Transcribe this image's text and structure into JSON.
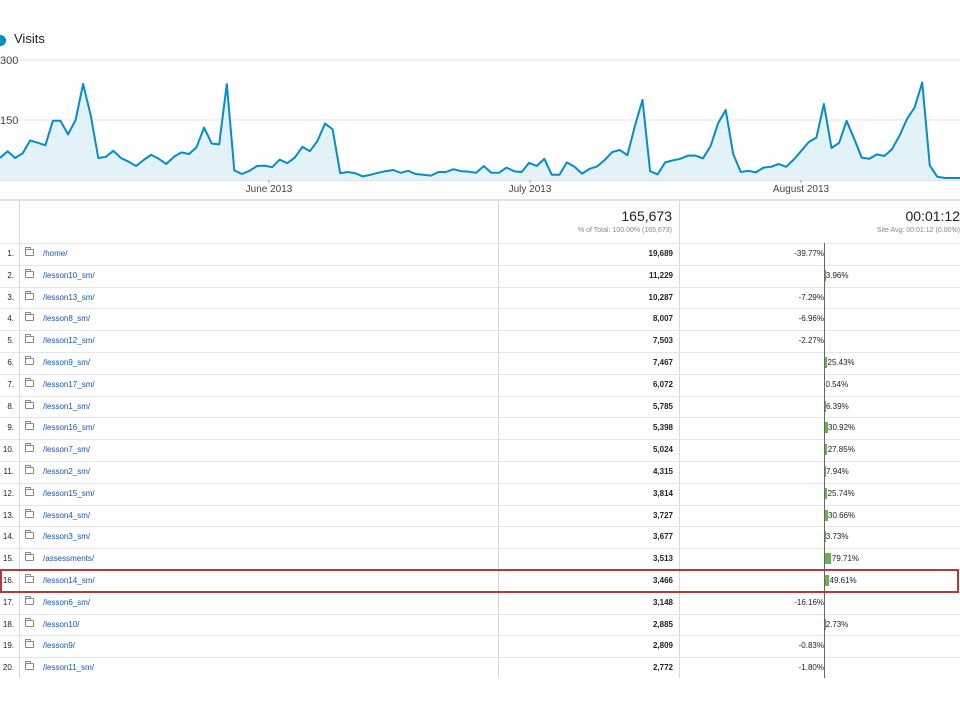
{
  "chart": {
    "legend_label": "Visits",
    "series_color": "#058dc7",
    "fill_color": "#e3f1f8",
    "y_ticks": [
      "300",
      "150"
    ],
    "y_max": 300,
    "x_labels": [
      "June 2013",
      "July 2013",
      "August 2013"
    ],
    "points": [
      55,
      72,
      55,
      67,
      99,
      93,
      87,
      148,
      148,
      114,
      150,
      240,
      162,
      55,
      58,
      73,
      55,
      46,
      35,
      50,
      63,
      53,
      40,
      58,
      69,
      65,
      82,
      131,
      91,
      89,
      240,
      24,
      15,
      23,
      35,
      36,
      32,
      51,
      42,
      56,
      83,
      72,
      98,
      141,
      127,
      17,
      20,
      17,
      9,
      13,
      18,
      22,
      25,
      18,
      23,
      15,
      13,
      11,
      20,
      20,
      27,
      22,
      21,
      18,
      35,
      18,
      18,
      31,
      22,
      20,
      43,
      35,
      53,
      13,
      13,
      44,
      33,
      16,
      28,
      34,
      50,
      70,
      75,
      62,
      136,
      200,
      22,
      14,
      44,
      49,
      53,
      61,
      61,
      54,
      85,
      142,
      175,
      65,
      20,
      23,
      19,
      31,
      33,
      40,
      33,
      51,
      73,
      95,
      106,
      190,
      80,
      93,
      148,
      103,
      56,
      53,
      64,
      60,
      77,
      111,
      153,
      181,
      244,
      36,
      8,
      5,
      5,
      5
    ]
  },
  "table": {
    "total_visits": "165,673",
    "total_visits_sub": "% of Total: 100.00% (165,673)",
    "total_time": "00:01:12",
    "total_time_sub": "Site Avg: 00:01:12 (0.00%)",
    "highlight_color": "#b23a3a",
    "positive_color": "#6ab150",
    "negative_color": "#cc3333",
    "rows": [
      {
        "num": "1.",
        "page": "/home/",
        "visits": "19,689",
        "pct": "-39.77%",
        "v": -39.77
      },
      {
        "num": "2.",
        "page": "/lesson10_sm/",
        "visits": "11,229",
        "pct": "3.96%",
        "v": 3.96
      },
      {
        "num": "3.",
        "page": "/lesson13_sm/",
        "visits": "10,287",
        "pct": "-7.29%",
        "v": -7.29
      },
      {
        "num": "4.",
        "page": "/lesson8_sm/",
        "visits": "8,007",
        "pct": "-6.96%",
        "v": -6.96
      },
      {
        "num": "5.",
        "page": "/lesson12_sm/",
        "visits": "7,503",
        "pct": "-2.27%",
        "v": -2.27
      },
      {
        "num": "6.",
        "page": "/lesson9_sm/",
        "visits": "7,467",
        "pct": "25.43%",
        "v": 25.43
      },
      {
        "num": "7.",
        "page": "/lesson17_sm/",
        "visits": "6,072",
        "pct": "0.54%",
        "v": 0.54
      },
      {
        "num": "8.",
        "page": "/lesson1_sm/",
        "visits": "5,785",
        "pct": "6.39%",
        "v": 6.39
      },
      {
        "num": "9.",
        "page": "/lesson16_sm/",
        "visits": "5,398",
        "pct": "30.92%",
        "v": 30.92
      },
      {
        "num": "10.",
        "page": "/lesson7_sm/",
        "visits": "5,024",
        "pct": "27.85%",
        "v": 27.85
      },
      {
        "num": "11.",
        "page": "/lesson2_sm/",
        "visits": "4,315",
        "pct": "7.94%",
        "v": 7.94
      },
      {
        "num": "12.",
        "page": "/lesson15_sm/",
        "visits": "3,814",
        "pct": "25.74%",
        "v": 25.74
      },
      {
        "num": "13.",
        "page": "/lesson4_sm/",
        "visits": "3,727",
        "pct": "30.66%",
        "v": 30.66
      },
      {
        "num": "14.",
        "page": "/lesson3_sm/",
        "visits": "3,677",
        "pct": "3.73%",
        "v": 3.73
      },
      {
        "num": "15.",
        "page": "/assessments/",
        "visits": "3,513",
        "pct": "79.71%",
        "v": 79.71
      },
      {
        "num": "16.",
        "page": "/lesson14_sm/",
        "visits": "3,466",
        "pct": "49.61%",
        "v": 49.61
      },
      {
        "num": "17.",
        "page": "/lesson6_sm/",
        "visits": "3,148",
        "pct": "-16.16%",
        "v": -16.16
      },
      {
        "num": "18.",
        "page": "/lesson10/",
        "visits": "2,885",
        "pct": "2.73%",
        "v": 2.73
      },
      {
        "num": "19.",
        "page": "/lesson9/",
        "visits": "2,809",
        "pct": "-0.83%",
        "v": -0.83
      },
      {
        "num": "20.",
        "page": "/lesson11_sm/",
        "visits": "2,772",
        "pct": "-1.80%",
        "v": -1.8
      }
    ]
  }
}
